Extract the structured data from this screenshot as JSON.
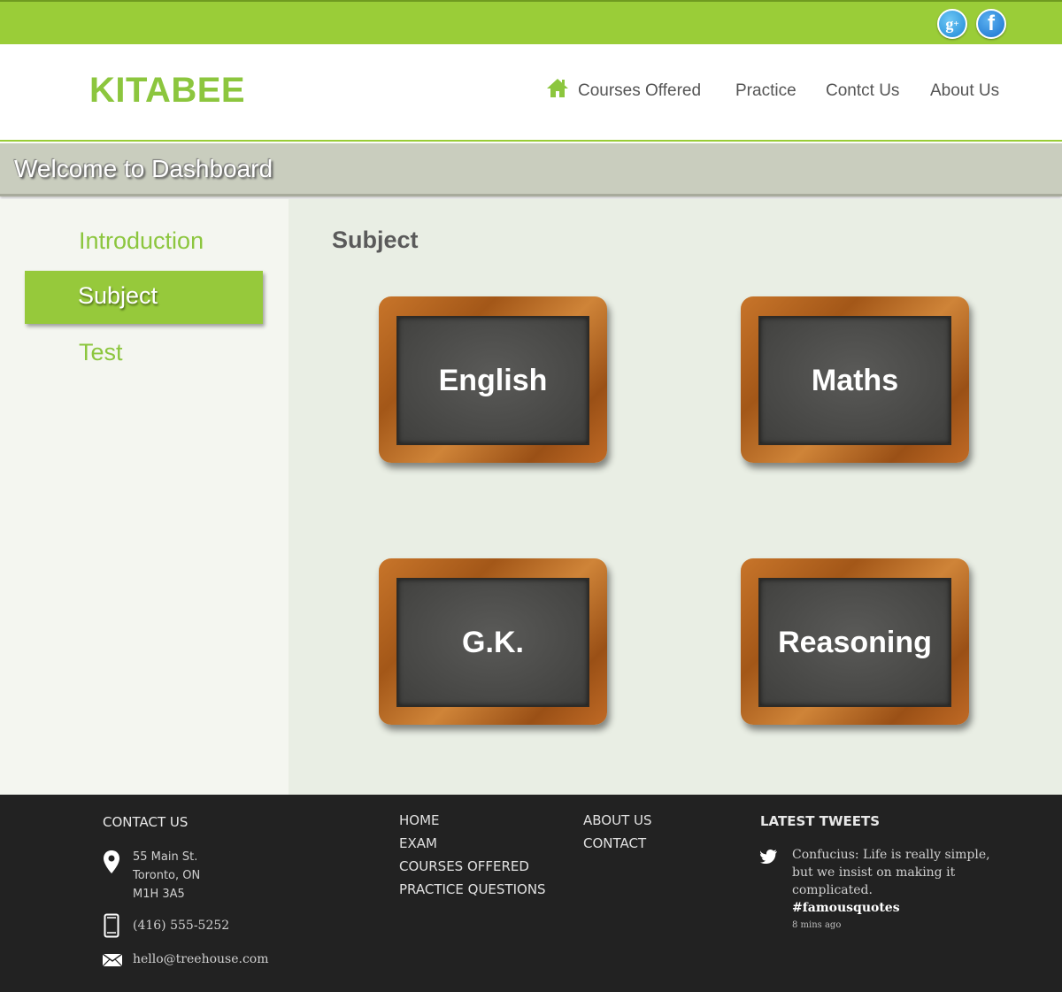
{
  "social": {
    "gplus_icon": "google-plus-icon",
    "gplus_glyph": "g",
    "gplus_sup": "+",
    "fb_icon": "facebook-icon",
    "fb_glyph": "f"
  },
  "header": {
    "logo": "KITABEE",
    "nav": [
      {
        "label": "Courses Offered",
        "icon": "home-icon"
      },
      {
        "label": "Practice"
      },
      {
        "label": "Contct Us"
      },
      {
        "label": "About Us"
      }
    ]
  },
  "welcome": {
    "title": "Welcome to Dashboard"
  },
  "sidebar": {
    "items": [
      {
        "label": "Introduction",
        "active": false
      },
      {
        "label": "Subject",
        "active": true
      },
      {
        "label": "Test",
        "active": false
      }
    ]
  },
  "main": {
    "title": "Subject",
    "subjects": [
      "English",
      "Maths",
      "G.K.",
      "Reasoning"
    ]
  },
  "footer": {
    "contact": {
      "heading": "CONTACT US",
      "address": [
        "55 Main St.",
        "Toronto, ON",
        "M1H 3A5"
      ],
      "phone": "(416) 555-5252",
      "email": "hello@treehouse.com"
    },
    "links_col1": [
      "HOME",
      "EXAM",
      "COURSES OFFERED",
      "PRACTICE QUESTIONS"
    ],
    "links_col2": [
      "ABOUT US",
      "CONTACT"
    ],
    "tweets": {
      "heading": "LATEST TWEETS",
      "text_lines": [
        "Confucius: Life is really simple,",
        "but we insist on making it",
        "complicated."
      ],
      "hashtag": "#famousquotes",
      "time": "8 mins ago"
    }
  },
  "colors": {
    "brand_green": "#9acd38",
    "footer_bg": "#222222",
    "content_bg": "#e9eee4"
  }
}
